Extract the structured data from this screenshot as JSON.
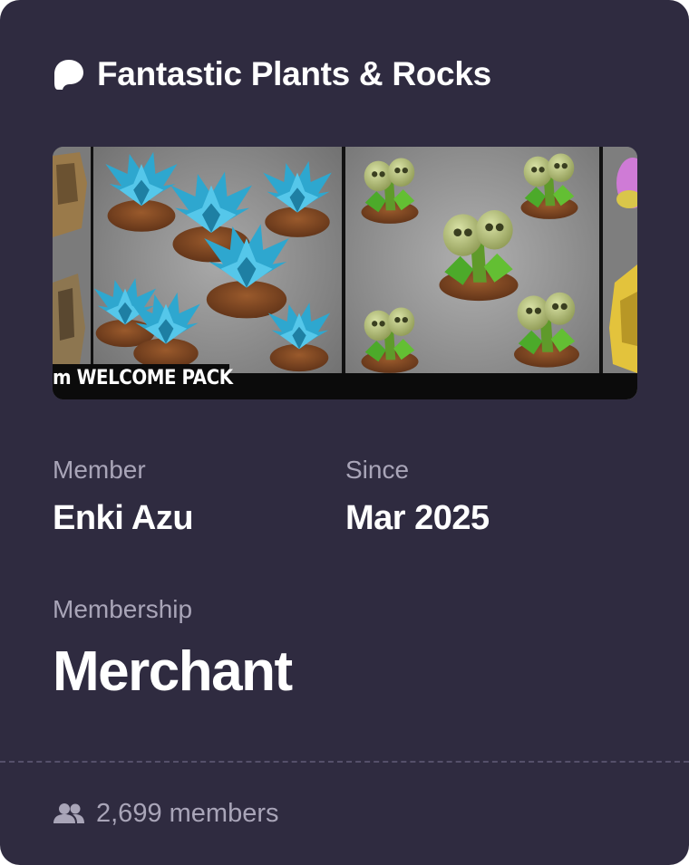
{
  "campaign": {
    "title": "Fantastic Plants & Rocks"
  },
  "banner": {
    "caption": "m WELCOME PACK"
  },
  "member": {
    "label": "Member",
    "name": "Enki Azu"
  },
  "since": {
    "label": "Since",
    "value": "Mar 2025"
  },
  "membership": {
    "label": "Membership",
    "tier": "Merchant"
  },
  "footer": {
    "icon": "members-icon",
    "count_text": "2,699 members"
  },
  "colors": {
    "card_background": "#2f2b40",
    "label_text": "#a9a5b8",
    "value_text": "#ffffff"
  }
}
